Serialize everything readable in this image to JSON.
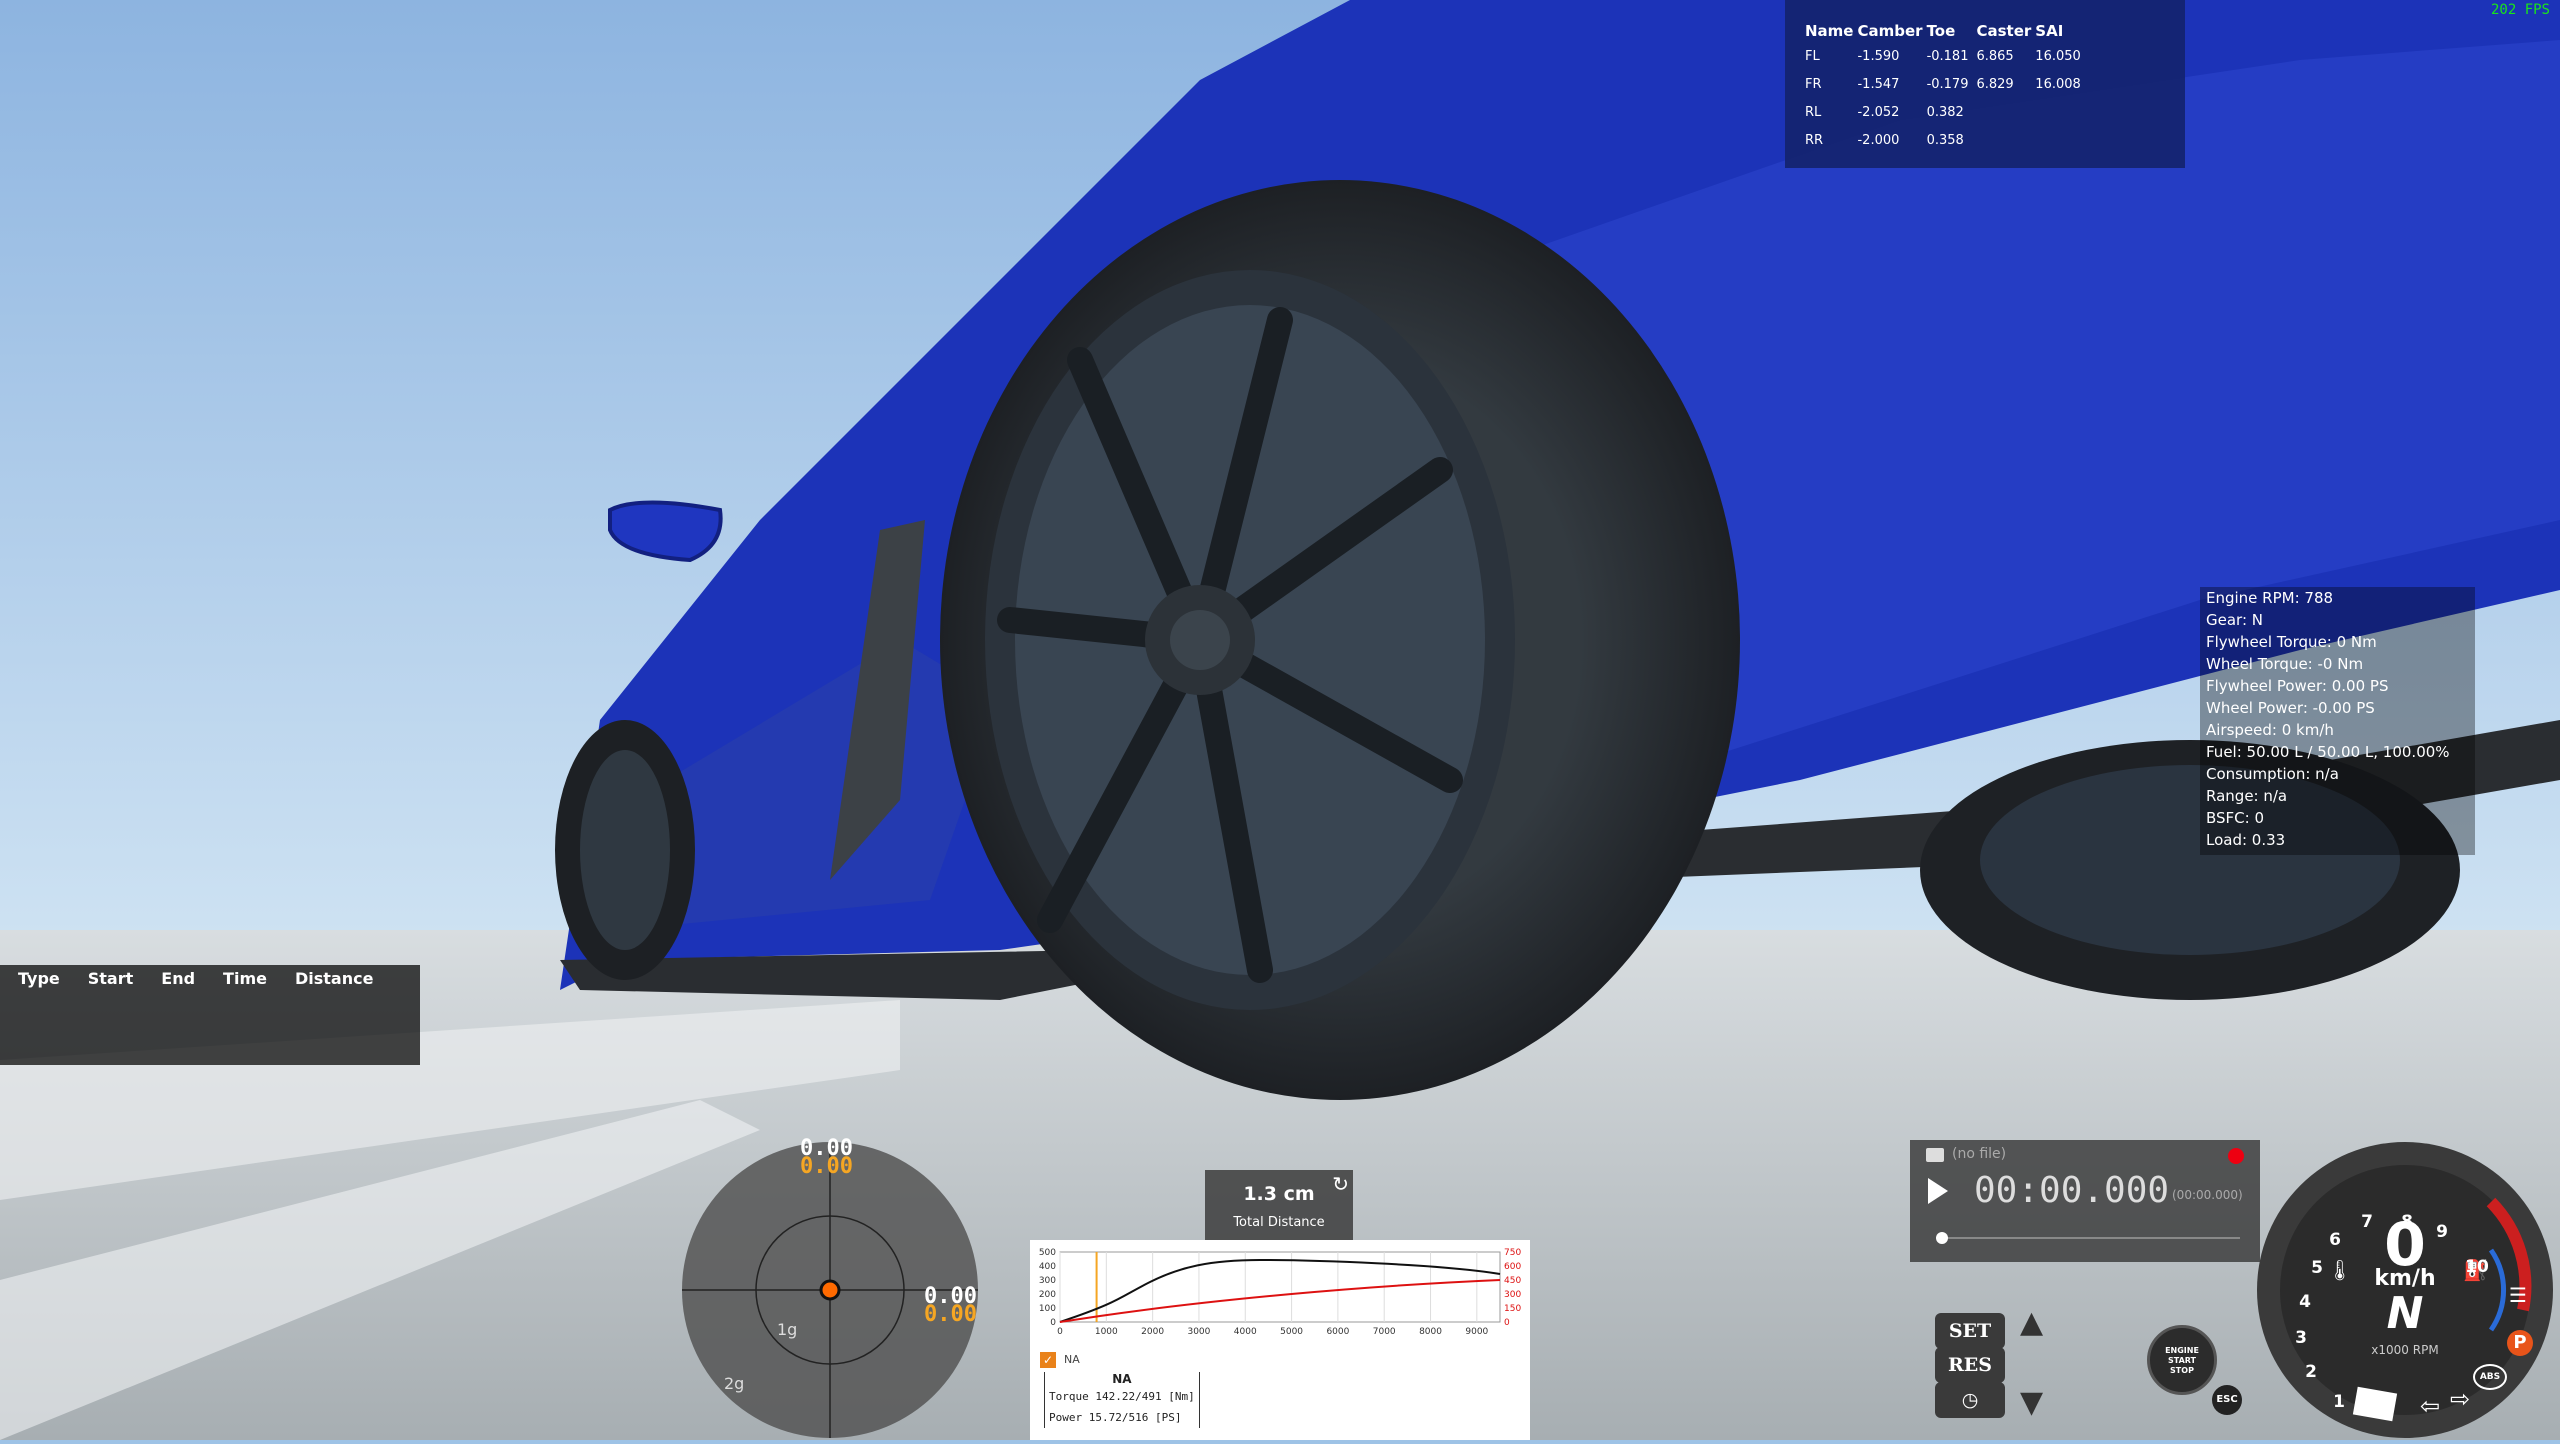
{
  "fps": "202 FPS",
  "alignment": {
    "headers": [
      "Name",
      "Camber",
      "Toe",
      "Caster",
      "SAI"
    ],
    "rows": [
      {
        "name": "FL",
        "camber": "-1.590",
        "toe": "-0.181",
        "caster": "6.865",
        "sai": "16.050"
      },
      {
        "name": "FR",
        "camber": "-1.547",
        "toe": "-0.179",
        "caster": "6.829",
        "sai": "16.008"
      },
      {
        "name": "RL",
        "camber": "-2.052",
        "toe": "0.382",
        "caster": "",
        "sai": ""
      },
      {
        "name": "RR",
        "camber": "-2.000",
        "toe": "0.358",
        "caster": "",
        "sai": ""
      }
    ]
  },
  "engine_info": [
    "Engine RPM: 788",
    "Gear: N",
    "Flywheel Torque: 0 Nm",
    "Wheel Torque: -0 Nm",
    "Flywheel Power: 0.00 PS",
    "Wheel Power: -0.00 PS",
    "Airspeed: 0 km/h",
    "Fuel: 50.00 L / 50.00 L, 100.00%",
    "Consumption: n/a",
    "Range: n/a",
    "BSFC: 0",
    "Load: 0.33"
  ],
  "timing": {
    "headers": [
      "Type",
      "Start",
      "End",
      "Time",
      "Distance"
    ]
  },
  "gmeter": {
    "top_white": "0.00",
    "top_orange": "0.00",
    "right_white": "0.00",
    "right_orange": "0.00",
    "ring1": "1g",
    "ring2": "2g",
    "colors": {
      "white": "#ffffff",
      "orange": "#f5a623",
      "dot": "#ff6a00"
    }
  },
  "distance": {
    "value": "1.3 cm",
    "label": "Total Distance",
    "reset_icon": "refresh-icon"
  },
  "torque_chart": {
    "left_ticks": [
      "500",
      "400",
      "300",
      "200",
      "100",
      "0"
    ],
    "right_ticks": [
      "750",
      "600",
      "450",
      "300",
      "150",
      "0"
    ],
    "x_ticks": [
      "0",
      "1000",
      "2000",
      "3000",
      "4000",
      "5000",
      "6000",
      "7000",
      "8000",
      "9000"
    ],
    "legend": "NA",
    "name": "NA",
    "torque_label": "Torque",
    "torque_value": "142.22/491 [Nm]",
    "power_label": "Power",
    "power_value": "15.72/516  [PS]",
    "torque_color": "#111111",
    "power_color": "#dd1111",
    "marker_color": "#f5a623"
  },
  "replay": {
    "file": "(no file)",
    "time": "00:00.000",
    "total": "(00:00.000)"
  },
  "cruise": {
    "set": "SET",
    "res": "RES"
  },
  "engine_button": {
    "line1": "ENGINE",
    "line2": "START",
    "line3": "STOP"
  },
  "esc_label": "ESC",
  "gauge": {
    "speed": "0",
    "unit": "km/h",
    "gear": "N",
    "rpm_label": "x1000 RPM",
    "ticks": [
      "1",
      "2",
      "3",
      "4",
      "5",
      "6",
      "7",
      "8",
      "9",
      "10"
    ],
    "parking": "P",
    "abs": "ABS",
    "accent": "#cc1f1f",
    "blue": "#2a6bd8"
  }
}
